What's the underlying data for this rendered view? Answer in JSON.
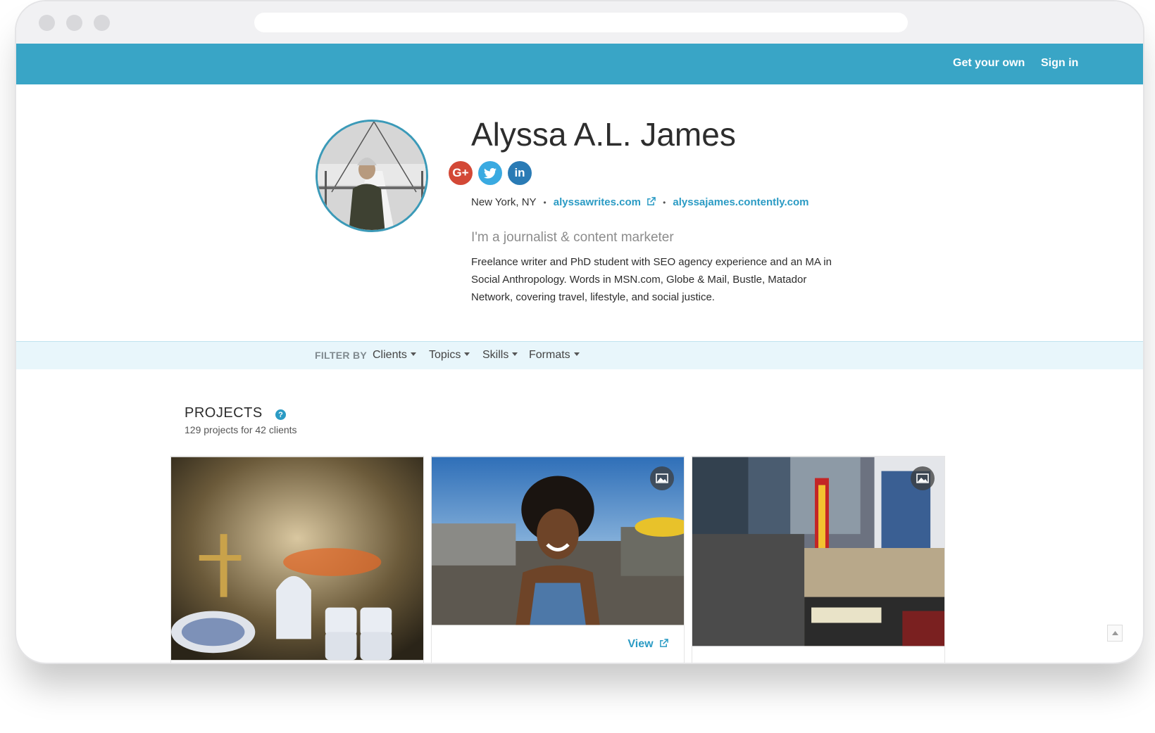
{
  "nav": {
    "get_your_own": "Get your own",
    "sign_in": "Sign in",
    "bar_color": "#39a5c6"
  },
  "profile": {
    "name": "Alyssa A.L. James",
    "social": [
      {
        "label": "G+",
        "icon": "google-plus-icon",
        "color": "#d34836"
      },
      {
        "label": "",
        "icon": "twitter-icon",
        "color": "#3aaae1"
      },
      {
        "label": "in",
        "icon": "linkedin-icon",
        "color": "#2a7bb5"
      }
    ],
    "location": "New York, NY",
    "website": "alyssawrites.com",
    "portfolio": "alyssajames.contently.com",
    "tagline": "I'm a journalist & content marketer",
    "bio": "Freelance writer and PhD student with SEO agency experience and an MA in Social Anthropology. Words in MSN.com, Globe & Mail, Bustle, Matador Network, covering travel, lifestyle, and social justice."
  },
  "filters": {
    "label": "FILTER BY",
    "items": [
      "Clients",
      "Topics",
      "Skills",
      "Formats"
    ]
  },
  "projects": {
    "title": "PROJECTS",
    "count": "129 projects for 42 clients",
    "cards": [
      {
        "image": "antique-teacups-photo",
        "badge": "",
        "link": ""
      },
      {
        "image": "smiling-woman-market-photo",
        "badge": "image-icon",
        "link": "View"
      },
      {
        "image": "apollo-theater-photo",
        "badge": "image-icon",
        "link": ""
      }
    ]
  },
  "accent_color": "#2b9bc4"
}
